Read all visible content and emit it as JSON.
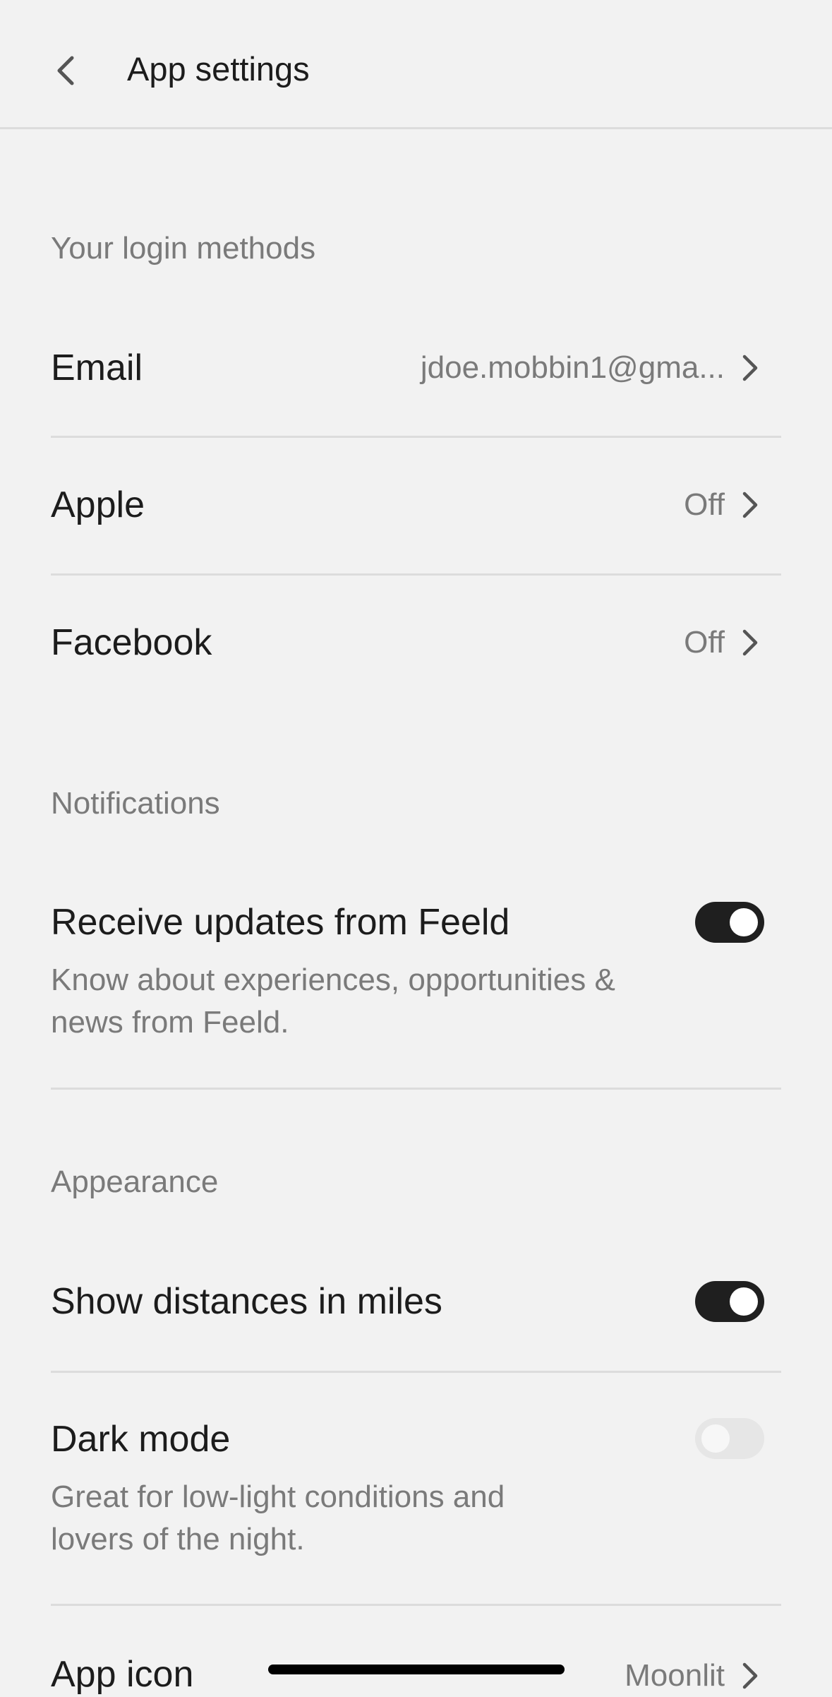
{
  "header": {
    "title": "App settings"
  },
  "login_section": {
    "label": "Your login methods",
    "items": [
      {
        "label": "Email",
        "value": "jdoe.mobbin1@gma..."
      },
      {
        "label": "Apple",
        "value": "Off"
      },
      {
        "label": "Facebook",
        "value": "Off"
      }
    ]
  },
  "notifications_section": {
    "label": "Notifications",
    "receive_updates": {
      "title": "Receive updates from Feeld",
      "description": "Know about experiences, opportunities & news from Feeld.",
      "enabled": true
    }
  },
  "appearance_section": {
    "label": "Appearance",
    "distances": {
      "title": "Show distances in miles",
      "enabled": true
    },
    "dark_mode": {
      "title": "Dark mode",
      "description": "Great for low-light conditions and lovers of the night.",
      "enabled": false
    },
    "app_icon": {
      "label": "App icon",
      "value": "Moonlit"
    }
  },
  "icons": {
    "back": "chevron-left-icon",
    "row_chevron": "chevron-right-icon"
  },
  "colors": {
    "background": "#f2f2f2",
    "toggle_on": "#1f1f1f",
    "toggle_off": "#e6e6e6",
    "secondary_text": "#7a7a7a"
  }
}
